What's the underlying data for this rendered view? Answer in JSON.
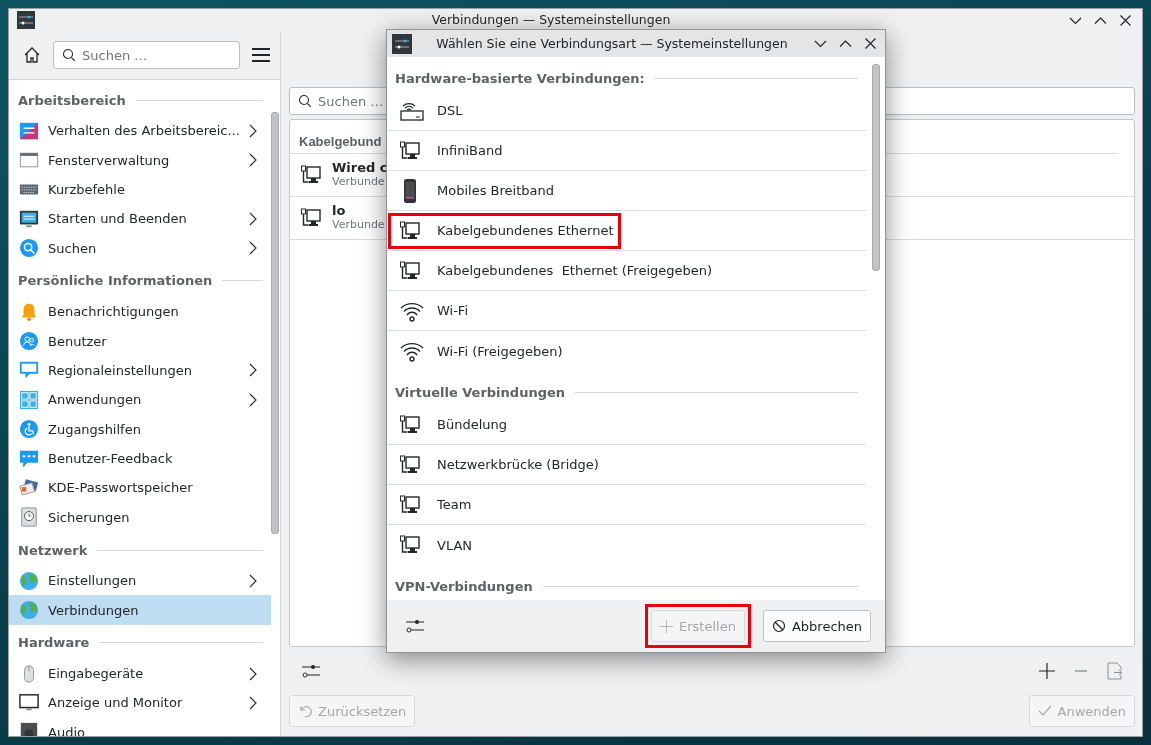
{
  "window": {
    "title": "Verbindungen — Systemeinstellungen"
  },
  "sidebar": {
    "search": {
      "placeholder": "Suchen …"
    },
    "sections": [
      {
        "title": "Arbeitsbereich",
        "items": [
          {
            "label": "Verhalten des Arbeitsbereic...",
            "kind": "workspace",
            "submenu": true,
            "selected": false
          },
          {
            "label": "Fensterverwaltung",
            "kind": "windows",
            "submenu": true,
            "selected": false
          },
          {
            "label": "Kurzbefehle",
            "kind": "keyboard",
            "submenu": false,
            "selected": false
          },
          {
            "label": "Starten und Beenden",
            "kind": "startup",
            "submenu": true,
            "selected": false
          },
          {
            "label": "Suchen",
            "kind": "search",
            "submenu": true,
            "selected": false
          }
        ]
      },
      {
        "title": "Persönliche Informationen",
        "items": [
          {
            "label": "Benachrichtigungen",
            "kind": "bell",
            "submenu": false,
            "selected": false
          },
          {
            "label": "Benutzer",
            "kind": "users",
            "submenu": false,
            "selected": false
          },
          {
            "label": "Regionaleinstellungen",
            "kind": "region",
            "submenu": true,
            "selected": false
          },
          {
            "label": "Anwendungen",
            "kind": "apps",
            "submenu": true,
            "selected": false
          },
          {
            "label": "Zugangshilfen",
            "kind": "accessibility",
            "submenu": false,
            "selected": false
          },
          {
            "label": "Benutzer-Feedback",
            "kind": "feedback",
            "submenu": false,
            "selected": false
          },
          {
            "label": "KDE-Passwortspeicher",
            "kind": "wallet",
            "submenu": false,
            "selected": false
          },
          {
            "label": "Sicherungen",
            "kind": "backup",
            "submenu": false,
            "selected": false
          }
        ]
      },
      {
        "title": "Netzwerk",
        "items": [
          {
            "label": "Einstellungen",
            "kind": "globe",
            "submenu": true,
            "selected": false
          },
          {
            "label": "Verbindungen",
            "kind": "globe",
            "submenu": false,
            "selected": true
          }
        ]
      },
      {
        "title": "Hardware",
        "items": [
          {
            "label": "Eingabegeräte",
            "kind": "mouse",
            "submenu": true,
            "selected": false
          },
          {
            "label": "Anzeige und Monitor",
            "kind": "monitor",
            "submenu": true,
            "selected": false
          },
          {
            "label": "Audio",
            "kind": "audio",
            "submenu": false,
            "selected": false
          }
        ]
      }
    ]
  },
  "connections": {
    "search": {
      "placeholder": "Suchen …"
    },
    "section_title": "Kabelgebund",
    "items": [
      {
        "name": "Wired c",
        "status": "Verbunde"
      },
      {
        "name": "lo",
        "status": "Verbunde"
      }
    ],
    "buttons": [
      {
        "label": "Zurücksetzen",
        "kind": "undo",
        "disabled": true
      },
      {
        "label": "Anwenden",
        "kind": "check",
        "disabled": true
      }
    ]
  },
  "dialog": {
    "title": "Wählen Sie eine Verbindungsart — Systemeinstellungen",
    "sections": [
      {
        "title": "Hardware-basierte Verbindungen:",
        "items": [
          {
            "label": "DSL",
            "kind": "dsl",
            "highlighted": false
          },
          {
            "label": "InfiniBand",
            "kind": "ethernet",
            "highlighted": false
          },
          {
            "label": "Mobiles Breitband",
            "kind": "phone",
            "highlighted": false
          },
          {
            "label": "Kabelgebundenes Ethernet",
            "kind": "ethernet",
            "highlighted": true
          },
          {
            "label": "Kabelgebundenes  Ethernet (Freigegeben)",
            "kind": "ethernet",
            "highlighted": false
          },
          {
            "label": "Wi-Fi",
            "kind": "wifi",
            "highlighted": false
          },
          {
            "label": "Wi-Fi (Freigegeben)",
            "kind": "wifi",
            "highlighted": false
          }
        ]
      },
      {
        "title": "Virtuelle Verbindungen",
        "items": [
          {
            "label": "Bündelung",
            "kind": "ethernet",
            "highlighted": false
          },
          {
            "label": "Netzwerkbrücke (Bridge)",
            "kind": "ethernet",
            "highlighted": false
          },
          {
            "label": "Team",
            "kind": "ethernet",
            "highlighted": false
          },
          {
            "label": "VLAN",
            "kind": "ethernet",
            "highlighted": false
          }
        ]
      },
      {
        "title": "VPN-Verbindungen"
      }
    ],
    "buttons": [
      {
        "label": "Erstellen",
        "kind": "plus",
        "disabled": true,
        "highlighted": true
      },
      {
        "label": "Abbrechen",
        "kind": "cancel",
        "disabled": false,
        "highlighted": false
      }
    ]
  }
}
